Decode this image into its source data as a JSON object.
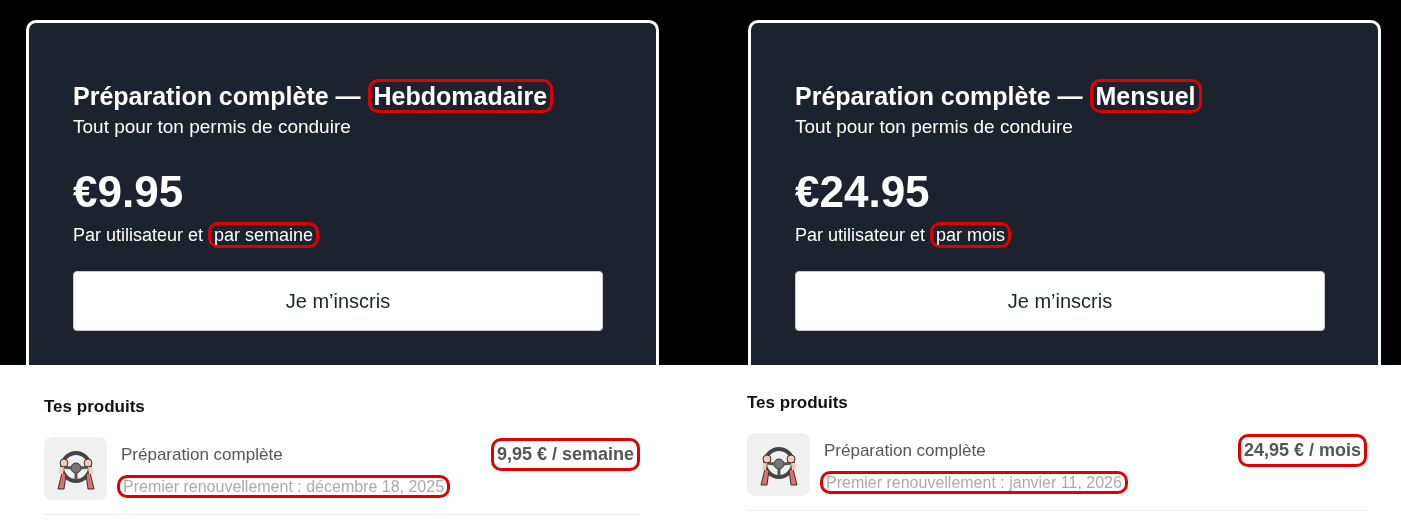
{
  "plans": [
    {
      "title": "Préparation complète —",
      "plan": "Hebdomadaire",
      "plan_highlighted": true,
      "subtitle": "Tout pour ton permis de conduire",
      "price": "€9.95",
      "period_prefix": "Par utilisateur et",
      "period": "par semaine",
      "period_highlighted": true,
      "button": "Je m’inscris"
    },
    {
      "title": "Préparation complète —",
      "plan": "Mensuel",
      "plan_highlighted": true,
      "subtitle": "Tout pour ton permis de conduire",
      "price": "€24.95",
      "period_prefix": "Par utilisateur et",
      "period": "par mois",
      "period_highlighted": true,
      "button": "Je m’inscris"
    }
  ],
  "products": [
    {
      "heading": "Tes produits",
      "items": [
        {
          "name": "Préparation complète",
          "price": "9,95 € / semaine",
          "price_highlighted": true,
          "renewal": "Premier renouvellement : décembre 18, 2025",
          "renewal_highlighted": true
        }
      ]
    },
    {
      "heading": "Tes produits",
      "items": [
        {
          "name": "Préparation complète",
          "price": "24,95 € / mois",
          "price_highlighted": true,
          "renewal": "Premier renouvellement : janvier 11, 2026",
          "renewal_highlighted": true
        }
      ]
    }
  ]
}
